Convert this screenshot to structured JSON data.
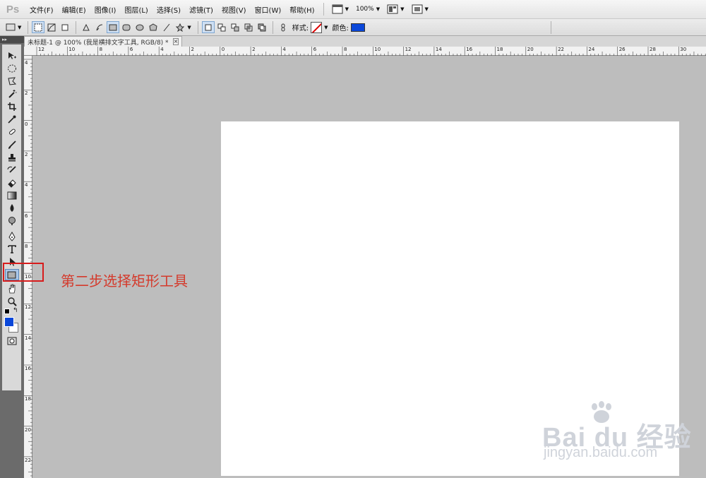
{
  "app": {
    "logo": "Ps"
  },
  "menu": [
    "文件(F)",
    "编辑(E)",
    "图像(I)",
    "图层(L)",
    "选择(S)",
    "滤镜(T)",
    "视图(V)",
    "窗口(W)",
    "帮助(H)"
  ],
  "menubar_tools": {
    "zoom": "100%"
  },
  "options": {
    "style_label": "样式:",
    "color_label": "颜色:",
    "color_value": "#0a47d9"
  },
  "document": {
    "tab_title": "未标题-1 @ 100% (我是横排文字工具, RGB/8) *"
  },
  "ruler": {
    "horizontal": [
      "12",
      "10",
      "8",
      "6",
      "4",
      "2",
      "0",
      "2",
      "4",
      "6",
      "8",
      "10",
      "12",
      "14",
      "16",
      "18",
      "20",
      "22",
      "24",
      "26",
      "28",
      "30"
    ],
    "vertical": [
      "4",
      "2",
      "0",
      "2",
      "4",
      "6",
      "8",
      "10",
      "12",
      "14",
      "16",
      "18",
      "20",
      "22"
    ]
  },
  "annotation": {
    "text": "第二步选择矩形工具"
  },
  "watermark": {
    "brand": "Bai du 经验",
    "url": "jingyan.baidu.com"
  },
  "colors": {
    "foreground": "#0a47d9",
    "background": "#ffffff",
    "highlight": "#d71c1c"
  }
}
